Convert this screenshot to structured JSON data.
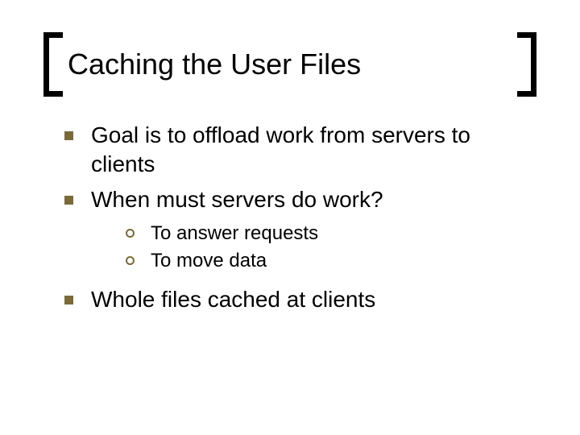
{
  "title": "Caching the User Files",
  "bullets": {
    "b1": "Goal is to offload work from servers to clients",
    "b2": "When must servers do work?",
    "b2_sub": {
      "s1": "To answer requests",
      "s2": "To move data"
    },
    "b3": "Whole files cached at clients"
  }
}
